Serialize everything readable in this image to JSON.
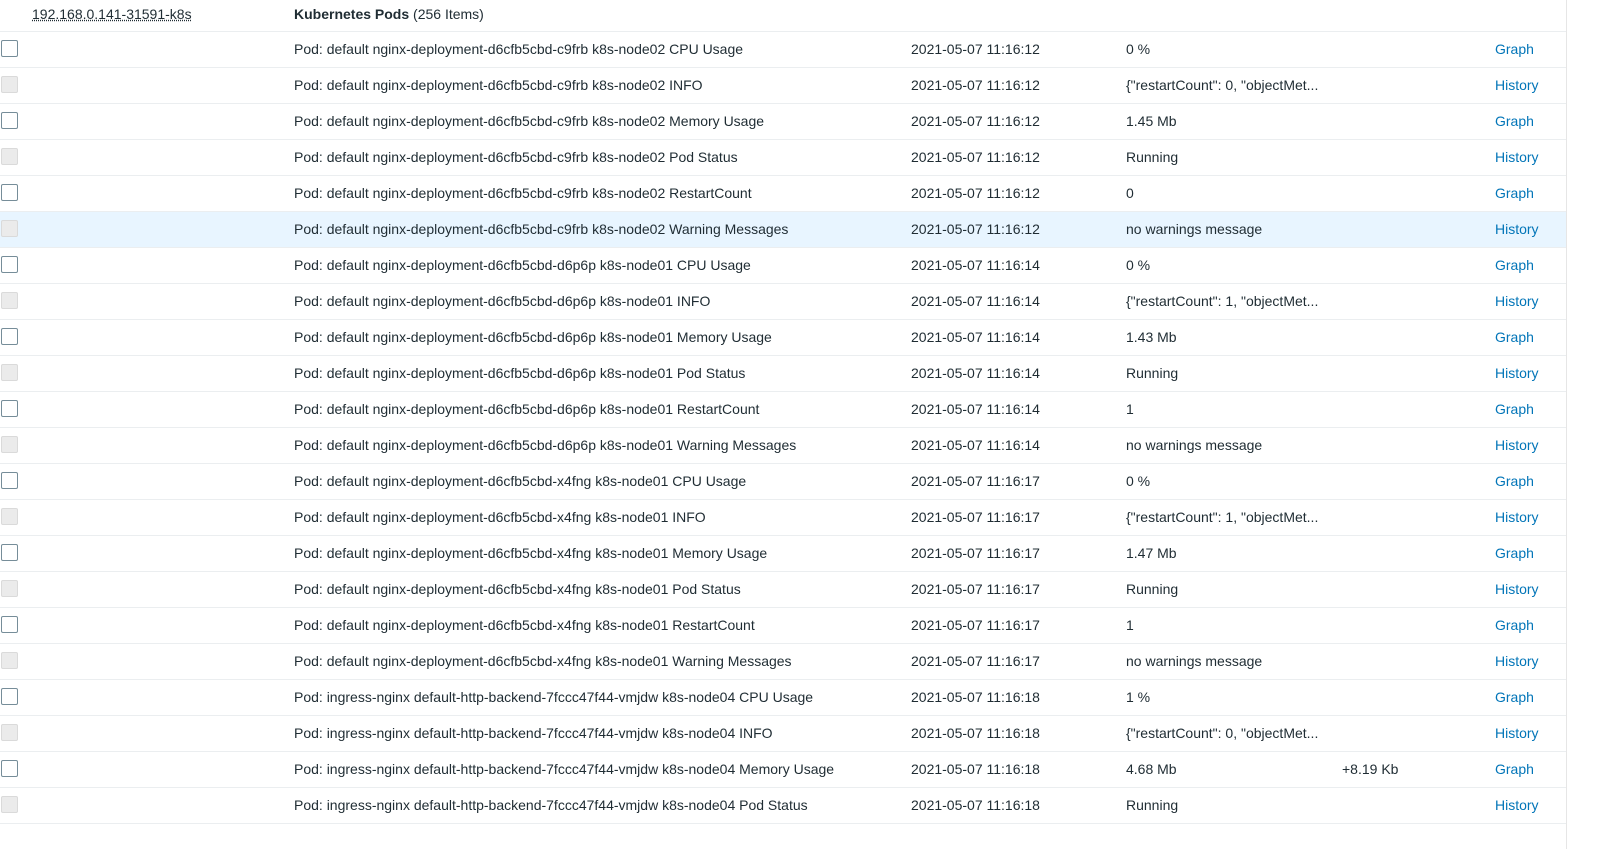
{
  "header": {
    "host": "192.168.0.141-31591-k8s",
    "group_name": "Kubernetes Pods",
    "group_count": "(256 Items)"
  },
  "colors": {
    "link": "#0275b8",
    "row_highlight": "#e8f5ff",
    "border": "#ebeef0"
  },
  "rows": [
    {
      "name": "Pod: default nginx-deployment-d6cfb5cbd-c9frb k8s-node02 CPU Usage",
      "time": "2021-05-07 11:16:12",
      "value": "0 %",
      "change": "",
      "action": "Graph"
    },
    {
      "name": "Pod: default nginx-deployment-d6cfb5cbd-c9frb k8s-node02 INFO",
      "time": "2021-05-07 11:16:12",
      "value": "{\"restartCount\": 0, \"objectMet...",
      "change": "",
      "action": "History"
    },
    {
      "name": "Pod: default nginx-deployment-d6cfb5cbd-c9frb k8s-node02 Memory Usage",
      "time": "2021-05-07 11:16:12",
      "value": "1.45 Mb",
      "change": "",
      "action": "Graph"
    },
    {
      "name": "Pod: default nginx-deployment-d6cfb5cbd-c9frb k8s-node02 Pod Status",
      "time": "2021-05-07 11:16:12",
      "value": "Running",
      "change": "",
      "action": "History"
    },
    {
      "name": "Pod: default nginx-deployment-d6cfb5cbd-c9frb k8s-node02 RestartCount",
      "time": "2021-05-07 11:16:12",
      "value": "0",
      "change": "",
      "action": "Graph"
    },
    {
      "name": "Pod: default nginx-deployment-d6cfb5cbd-c9frb k8s-node02 Warning Messages",
      "time": "2021-05-07 11:16:12",
      "value": "no warnings message",
      "change": "",
      "action": "History"
    },
    {
      "name": "Pod: default nginx-deployment-d6cfb5cbd-d6p6p k8s-node01 CPU Usage",
      "time": "2021-05-07 11:16:14",
      "value": "0 %",
      "change": "",
      "action": "Graph"
    },
    {
      "name": "Pod: default nginx-deployment-d6cfb5cbd-d6p6p k8s-node01 INFO",
      "time": "2021-05-07 11:16:14",
      "value": "{\"restartCount\": 1, \"objectMet...",
      "change": "",
      "action": "History"
    },
    {
      "name": "Pod: default nginx-deployment-d6cfb5cbd-d6p6p k8s-node01 Memory Usage",
      "time": "2021-05-07 11:16:14",
      "value": "1.43 Mb",
      "change": "",
      "action": "Graph"
    },
    {
      "name": "Pod: default nginx-deployment-d6cfb5cbd-d6p6p k8s-node01 Pod Status",
      "time": "2021-05-07 11:16:14",
      "value": "Running",
      "change": "",
      "action": "History"
    },
    {
      "name": "Pod: default nginx-deployment-d6cfb5cbd-d6p6p k8s-node01 RestartCount",
      "time": "2021-05-07 11:16:14",
      "value": "1",
      "change": "",
      "action": "Graph"
    },
    {
      "name": "Pod: default nginx-deployment-d6cfb5cbd-d6p6p k8s-node01 Warning Messages",
      "time": "2021-05-07 11:16:14",
      "value": "no warnings message",
      "change": "",
      "action": "History"
    },
    {
      "name": "Pod: default nginx-deployment-d6cfb5cbd-x4fng k8s-node01 CPU Usage",
      "time": "2021-05-07 11:16:17",
      "value": "0 %",
      "change": "",
      "action": "Graph"
    },
    {
      "name": "Pod: default nginx-deployment-d6cfb5cbd-x4fng k8s-node01 INFO",
      "time": "2021-05-07 11:16:17",
      "value": "{\"restartCount\": 1, \"objectMet...",
      "change": "",
      "action": "History"
    },
    {
      "name": "Pod: default nginx-deployment-d6cfb5cbd-x4fng k8s-node01 Memory Usage",
      "time": "2021-05-07 11:16:17",
      "value": "1.47 Mb",
      "change": "",
      "action": "Graph"
    },
    {
      "name": "Pod: default nginx-deployment-d6cfb5cbd-x4fng k8s-node01 Pod Status",
      "time": "2021-05-07 11:16:17",
      "value": "Running",
      "change": "",
      "action": "History"
    },
    {
      "name": "Pod: default nginx-deployment-d6cfb5cbd-x4fng k8s-node01 RestartCount",
      "time": "2021-05-07 11:16:17",
      "value": "1",
      "change": "",
      "action": "Graph"
    },
    {
      "name": "Pod: default nginx-deployment-d6cfb5cbd-x4fng k8s-node01 Warning Messages",
      "time": "2021-05-07 11:16:17",
      "value": "no warnings message",
      "change": "",
      "action": "History"
    },
    {
      "name": "Pod: ingress-nginx default-http-backend-7fccc47f44-vmjdw k8s-node04 CPU Usage",
      "time": "2021-05-07 11:16:18",
      "value": "1 %",
      "change": "",
      "action": "Graph"
    },
    {
      "name": "Pod: ingress-nginx default-http-backend-7fccc47f44-vmjdw k8s-node04 INFO",
      "time": "2021-05-07 11:16:18",
      "value": "{\"restartCount\": 0, \"objectMet...",
      "change": "",
      "action": "History"
    },
    {
      "name": "Pod: ingress-nginx default-http-backend-7fccc47f44-vmjdw k8s-node04 Memory Usage",
      "time": "2021-05-07 11:16:18",
      "value": "4.68 Mb",
      "change": "+8.19 Kb",
      "action": "Graph"
    },
    {
      "name": "Pod: ingress-nginx default-http-backend-7fccc47f44-vmjdw k8s-node04 Pod Status",
      "time": "2021-05-07 11:16:18",
      "value": "Running",
      "change": "",
      "action": "History"
    }
  ]
}
